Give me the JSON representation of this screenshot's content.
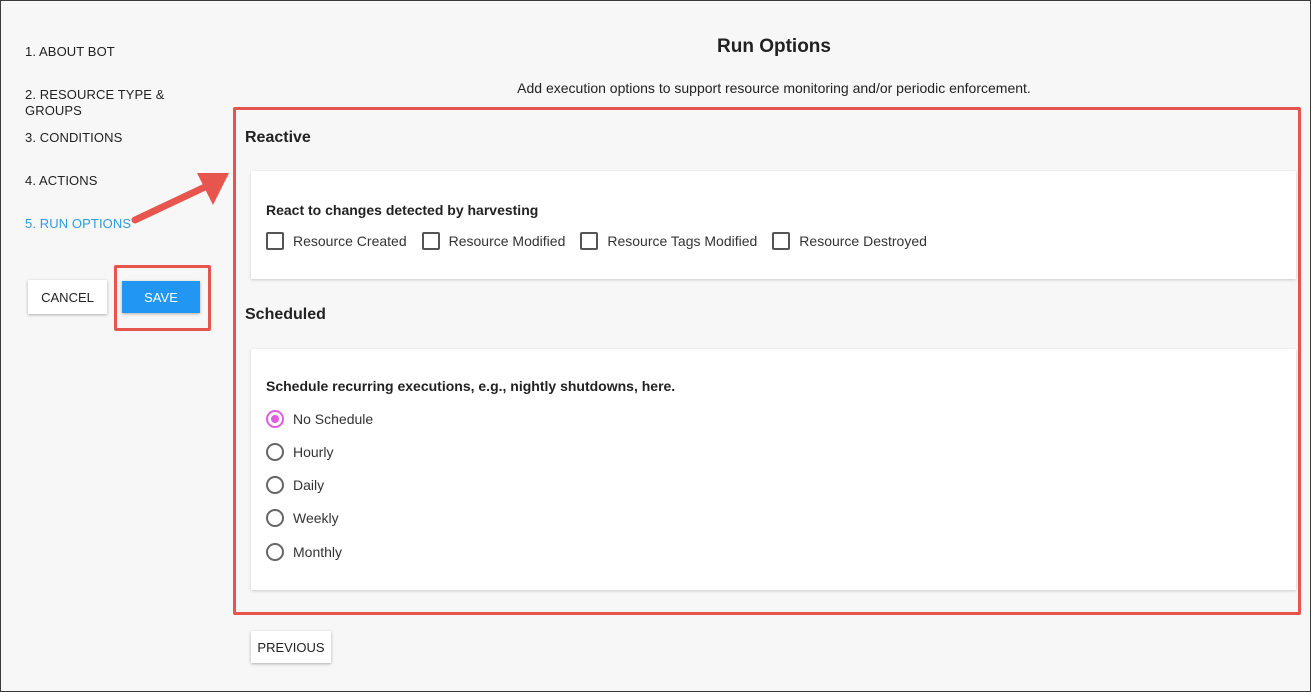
{
  "sidebar": {
    "steps": [
      {
        "label": "1. ABOUT BOT"
      },
      {
        "label": "2. RESOURCE TYPE & GROUPS"
      },
      {
        "label": "3. CONDITIONS"
      },
      {
        "label": "4. ACTIONS"
      },
      {
        "label": "5. RUN OPTIONS"
      }
    ],
    "cancel_label": "CANCEL",
    "save_label": "SAVE"
  },
  "main": {
    "title": "Run Options",
    "subtitle": "Add execution options to support resource monitoring and/or periodic enforcement.",
    "reactive": {
      "title": "Reactive",
      "heading": "React to changes detected by harvesting",
      "checkboxes": [
        {
          "label": "Resource Created",
          "checked": false
        },
        {
          "label": "Resource Modified",
          "checked": false
        },
        {
          "label": "Resource Tags Modified",
          "checked": false
        },
        {
          "label": "Resource Destroyed",
          "checked": false
        }
      ]
    },
    "scheduled": {
      "title": "Scheduled",
      "heading": "Schedule recurring executions, e.g., nightly shutdowns, here.",
      "options": [
        {
          "label": "No Schedule",
          "selected": true
        },
        {
          "label": "Hourly",
          "selected": false
        },
        {
          "label": "Daily",
          "selected": false
        },
        {
          "label": "Weekly",
          "selected": false
        },
        {
          "label": "Monthly",
          "selected": false
        }
      ]
    },
    "previous_label": "PREVIOUS"
  },
  "colors": {
    "accent": "#2196f3",
    "active_step": "#2d9be0",
    "highlight": "#e8554e",
    "radio_selected": "#e05ce0"
  }
}
